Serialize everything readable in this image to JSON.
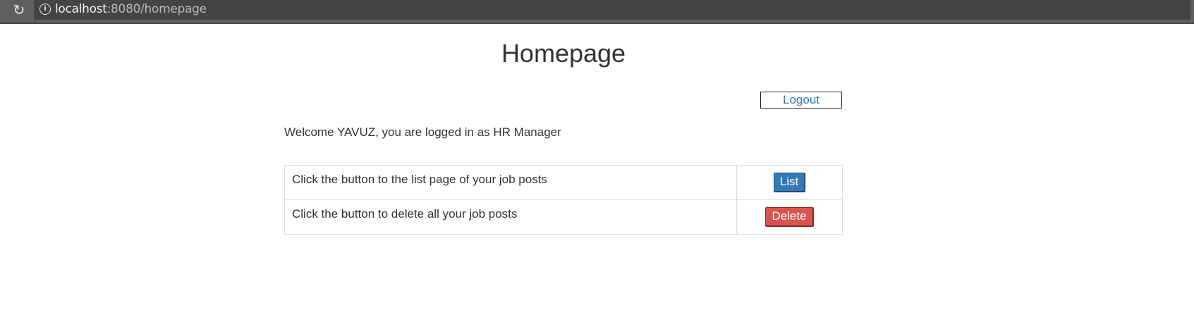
{
  "browser": {
    "url_host": "localhost",
    "url_rest": ":8080/homepage"
  },
  "page": {
    "title": "Homepage",
    "logout_label": "Logout",
    "welcome_text": "Welcome YAVUZ, you are logged in as HR Manager"
  },
  "actions": [
    {
      "description": "Click the button to the list page of your job posts",
      "button_label": "List",
      "button_color": "#337ab7"
    },
    {
      "description": "Click the button to delete all your job posts",
      "button_label": "Delete",
      "button_color": "#d9534f"
    }
  ],
  "icons": {
    "reload": "reload-icon",
    "info": "info-icon"
  }
}
